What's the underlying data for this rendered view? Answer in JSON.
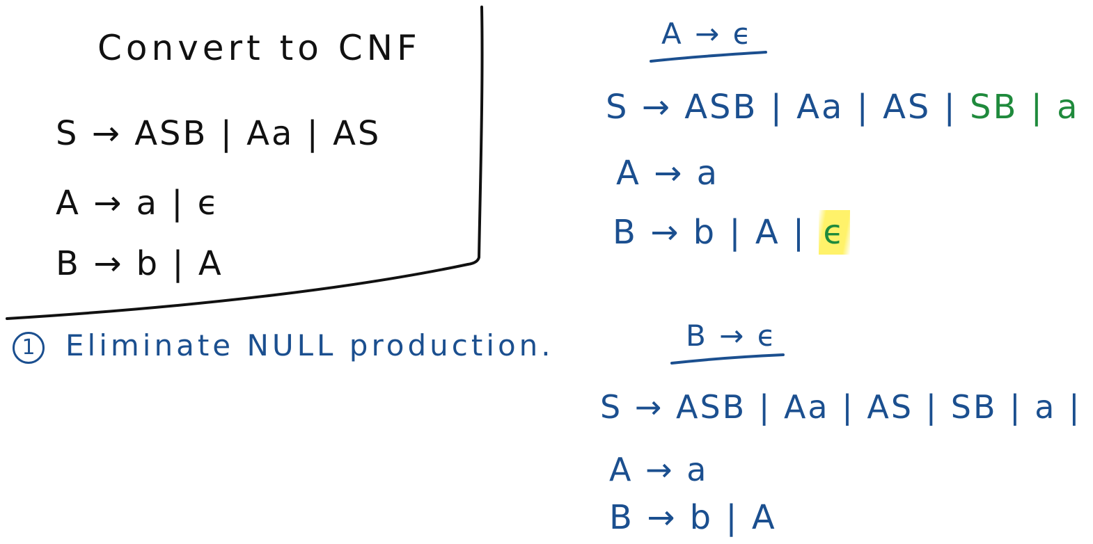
{
  "box": {
    "title": "Convert to CNF",
    "rules": [
      "S → ASB | Aa | AS",
      "A → a | ϵ",
      "B → b | A"
    ]
  },
  "step": {
    "number": "1",
    "text": "Eliminate NULL production."
  },
  "section_a": {
    "heading": "A → ϵ",
    "s_rule_main": "S → ASB | Aa | AS |",
    "s_rule_added": " SB | a | S",
    "a_rule": "A → a",
    "b_rule_main": "B → b | A |",
    "b_rule_highlight": "ϵ"
  },
  "section_b": {
    "heading": "B → ϵ",
    "s_rule": "S → ASB | Aa | AS | SB | a | S",
    "a_rule": "A → a",
    "b_rule": "B → b | A"
  },
  "colors": {
    "black": "#111111",
    "blue": "#1b4f8f",
    "green": "#1f8a3c",
    "highlight": "#fff050"
  }
}
